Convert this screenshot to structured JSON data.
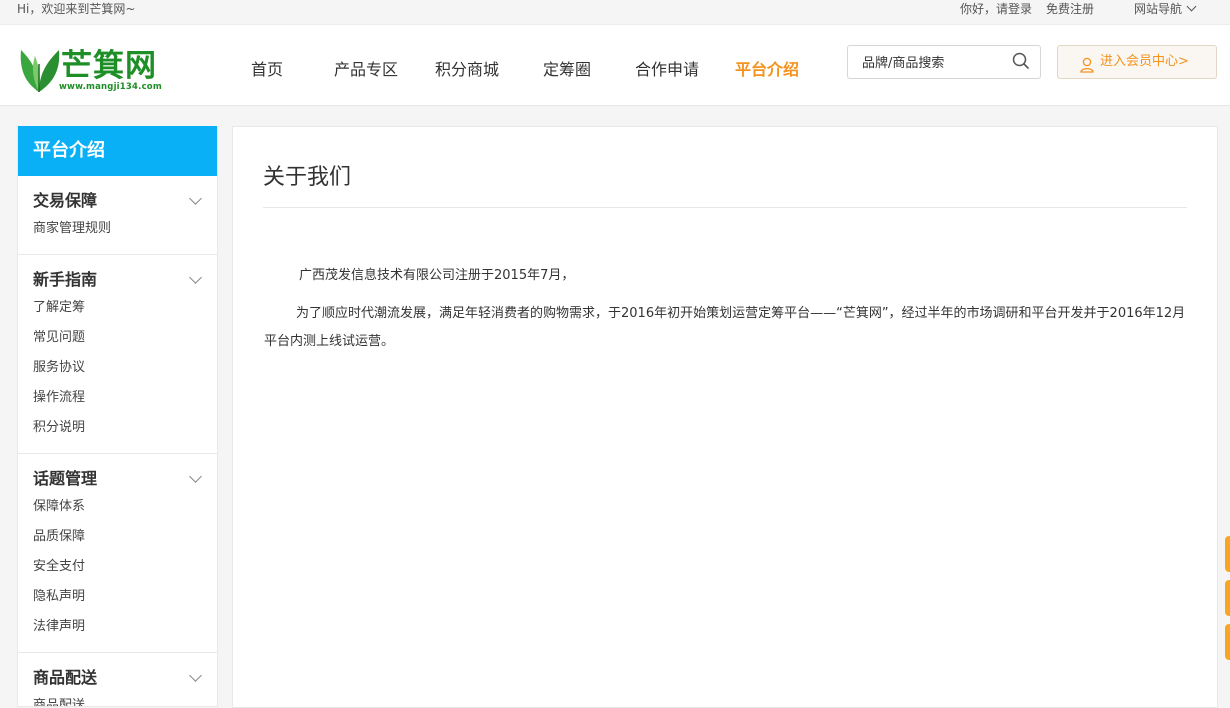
{
  "topbar": {
    "welcome": "Hi，欢迎来到芒箕网~",
    "login": "你好，请登录",
    "register": "免费注册",
    "site_nav": "网站导航"
  },
  "header": {
    "logo_text": "芒箕网",
    "logo_url": "www.mangji134.com",
    "nav": [
      {
        "label": "首页",
        "active": false
      },
      {
        "label": "产品专区",
        "active": false
      },
      {
        "label": "积分商城",
        "active": false
      },
      {
        "label": "定筹圈",
        "active": false
      },
      {
        "label": "合作申请",
        "active": false
      },
      {
        "label": "平台介绍",
        "active": true
      }
    ],
    "search_placeholder": "品牌/商品搜索",
    "member_center": "进入会员中心>"
  },
  "sidebar": {
    "title": "平台介绍",
    "groups": [
      {
        "title": "交易保障",
        "items": [
          "商家管理规则"
        ]
      },
      {
        "title": "新手指南",
        "items": [
          "了解定筹",
          "常见问题",
          "服务协议",
          "操作流程",
          "积分说明"
        ]
      },
      {
        "title": "话题管理",
        "items": [
          "保障体系",
          "品质保障",
          "安全支付",
          "隐私声明",
          "法律声明"
        ]
      },
      {
        "title": "商品配送",
        "items": [
          "商品配送"
        ]
      }
    ]
  },
  "main": {
    "heading": "关于我们",
    "paragraph1": "广西茂发信息技术有限公司注册于2015年7月，",
    "paragraph2": "为了顺应时代潮流发展，满足年轻消费者的购物需求，于2016年初开始策划运营定筹平台——“芒箕网”，经过半年的市场调研和平台开发并于2016年12月平台内测上线试运营。"
  },
  "colors": {
    "accent_orange": "#f5921e",
    "sidebar_header_blue": "#0ab0f5",
    "logo_green": "#1e8e26"
  }
}
